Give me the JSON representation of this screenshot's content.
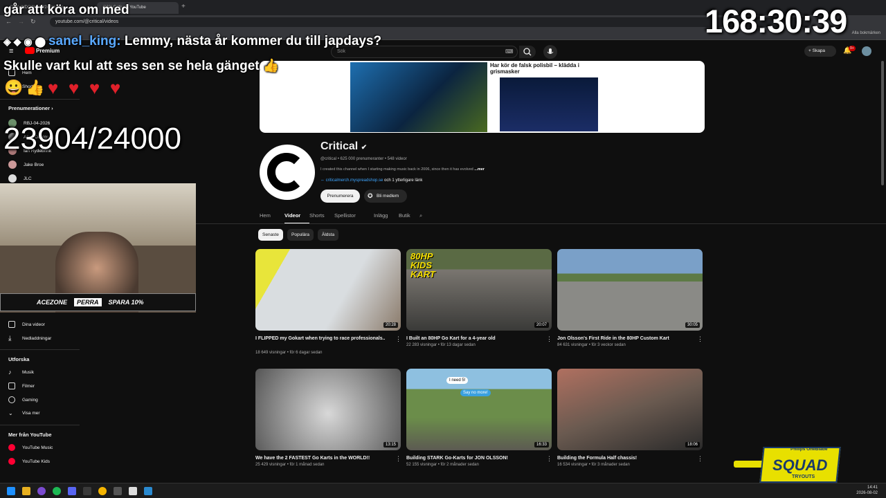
{
  "browser": {
    "tabs": [
      "(203) INDOWS 17/24 lite ens...",
      "(203) Critical - YouTube"
    ],
    "url": "youtube.com/@critical/videos",
    "profile": "Alla bokmärken"
  },
  "header": {
    "logo": "Premium",
    "search_placeholder": "Sök",
    "create_label": "Skapa",
    "notif_count": "9+"
  },
  "sidebar": {
    "top_items": [
      "Hem",
      "Shorts"
    ],
    "subscriptions_title": "Prenumerationer",
    "subscriptions": [
      "RBJ-04-2026",
      "Allan Dahlgren",
      "Ian Rydebrink",
      "Jake Broe",
      "JLC"
    ],
    "you_items": [
      "Dina videor",
      "Nedladdningar"
    ],
    "explore_title": "Utforska",
    "explore_items": [
      "Musik",
      "Filmer",
      "Gaming",
      "Visa mer"
    ],
    "more_title": "Mer från YouTube",
    "more_items": [
      "YouTube Music",
      "YouTube Kids"
    ]
  },
  "channel": {
    "banner_headline": "Har kör de falsk polisbil – klädda i grismasker",
    "name": "Critical",
    "handle_meta": "@critical • 625 000 prenumeranter • 548 videor",
    "description": "I created this channel when I starting making music back in 2006, since then it has evolved",
    "desc_more": "...mer",
    "link": "criticalmerch.myspreadshop.se",
    "link_extra": "och 1 ytterligare länk",
    "subscribe": "Prenumerera",
    "join": "Bli medlem",
    "tabs": [
      "Hem",
      "Videor",
      "Shorts",
      "Spellistor",
      "Inlägg",
      "Butik"
    ],
    "active_tab": "Videor",
    "chips": [
      "Senaste",
      "Populära",
      "Äldsta"
    ]
  },
  "videos": [
    {
      "title": "I FLIPPED my Gokart when trying to race professionals..",
      "meta": "18 649 visningar • för 6 dagar sedan",
      "duration": "20:28"
    },
    {
      "title": "I Built an 80HP Go Kart for a 4-year old",
      "meta": "22 283 visningar • för 13 dagar sedan",
      "duration": "20:07"
    },
    {
      "title": "Jon Olsson's First Ride in the 80HP Custom Kart",
      "meta": "84 631 visningar • för 3 veckor sedan",
      "duration": "30:05"
    },
    {
      "title": "We have the 2 FASTEST Go Karts in the WORLD!!",
      "meta": "25 429 visningar • för 1 månad sedan",
      "duration": "13:15"
    },
    {
      "title": "Building STARK Go-Karts for JON OLSSON!",
      "meta": "52 155 visningar • för 2 månader sedan",
      "duration": "16:33"
    },
    {
      "title": "Building the Formula Half chassis!",
      "meta": "16 534 visningar • för 3 månader sedan",
      "duration": "18:06"
    }
  ],
  "thumb_labels": {
    "kart": "80HP KIDS KART",
    "bubble1": "I need 5!",
    "bubble2": "Say no more!"
  },
  "overlay": {
    "top_text": "går att köra om med",
    "chat_user": "sanel_king:",
    "chat_msg": "Lemmy, nästa år kommer du till japdays? Skulle vart kul att ses sen se hela gänget",
    "timer": "168:30:39",
    "counter": "23904/24000",
    "sponsor": [
      "ACEZONE",
      "PERRA",
      "SPARA 10%"
    ],
    "squad_brand": "Philips OneBlade",
    "squad_title": "SQUAD",
    "squad_sub": "TRYOUTS"
  },
  "taskbar": {
    "time": "14:41",
    "date": "2026-08-02"
  }
}
